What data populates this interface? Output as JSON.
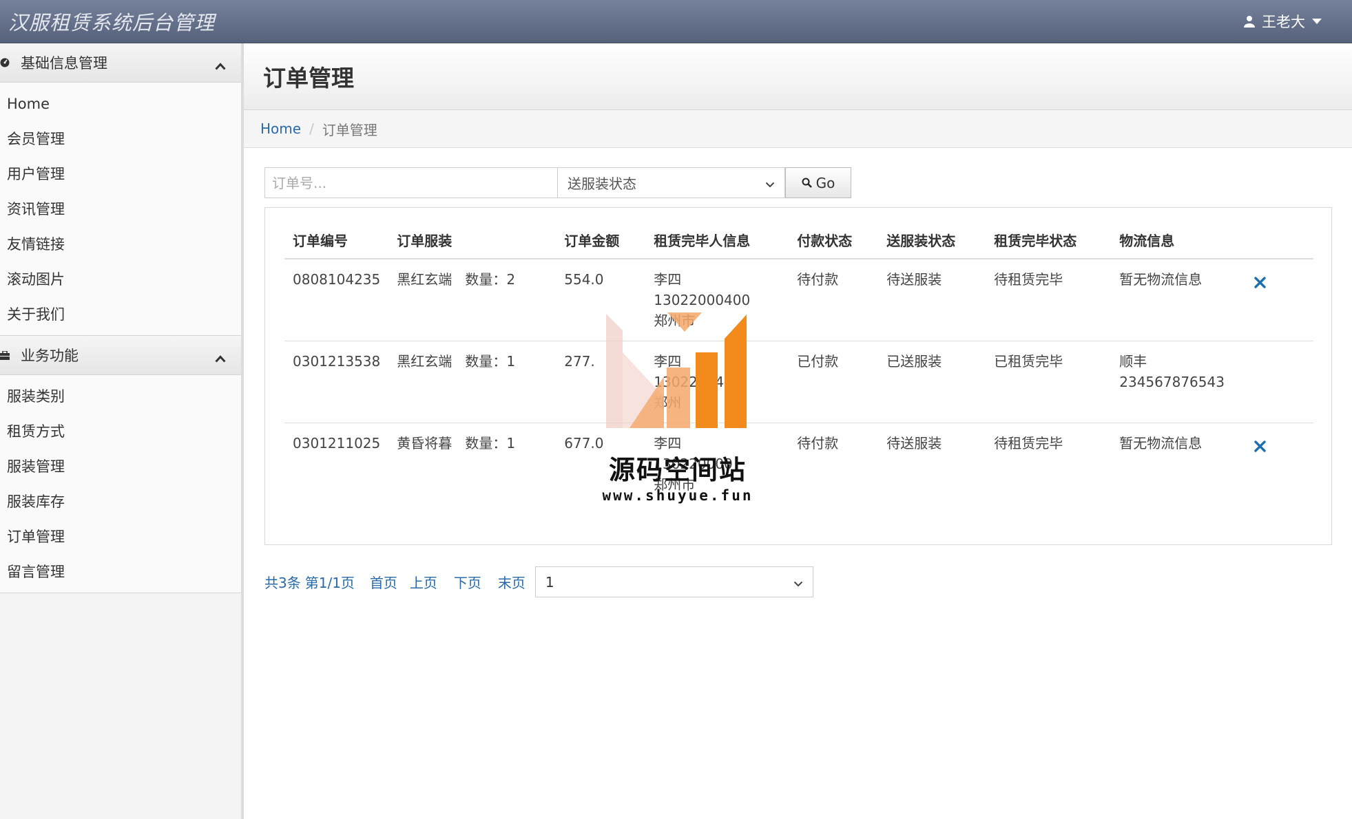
{
  "header": {
    "app_title": "汉服租赁系统后台管理",
    "user_name": "王老大"
  },
  "sidebar": {
    "groups": [
      {
        "title": "基础信息管理",
        "icon": "dashboard-icon",
        "items": [
          "Home",
          "会员管理",
          "用户管理",
          "资讯管理",
          "友情链接",
          "滚动图片",
          "关于我们"
        ]
      },
      {
        "title": "业务功能",
        "icon": "briefcase-icon",
        "items": [
          "服装类别",
          "租赁方式",
          "服装管理",
          "服装库存",
          "订单管理",
          "留言管理"
        ]
      }
    ]
  },
  "main": {
    "page_title": "订单管理",
    "breadcrumb": {
      "home": "Home",
      "separator": "/",
      "current": "订单管理"
    },
    "search": {
      "order_placeholder": "订单号...",
      "status_select_value": "送服装状态",
      "go_label": "Go"
    },
    "table": {
      "headers": [
        "订单编号",
        "订单服装",
        "订单金额",
        "租赁完毕人信息",
        "付款状态",
        "送服装状态",
        "租赁完毕状态",
        "物流信息"
      ],
      "rows": [
        {
          "order_no": "0808104235",
          "clothing": "黑红玄端",
          "qty_label": "数量：2",
          "amount": "554.0",
          "renter_name": "李四",
          "renter_phone": "13022000400",
          "renter_city": "郑州市",
          "pay_status": "待付款",
          "delivery_status": "待送服装",
          "rent_status": "待租赁完毕",
          "logistics_line1": "暂无物流信息",
          "logistics_line2": "",
          "deletable": true
        },
        {
          "order_no": "0301213538",
          "clothing": "黑红玄端",
          "qty_label": "数量：1",
          "amount": "277.",
          "renter_name": "李四",
          "renter_phone": "1302200400",
          "renter_city": "郑州",
          "pay_status": "已付款",
          "delivery_status": "已送服装",
          "rent_status": "已租赁完毕",
          "logistics_line1": "顺丰",
          "logistics_line2": "234567876543",
          "deletable": false
        },
        {
          "order_no": "0301211025",
          "clothing": "黄昏将暮",
          "qty_label": "数量：1",
          "amount": "677.0",
          "renter_name": "李四",
          "renter_phone": "130220000",
          "renter_city": "郑州市",
          "pay_status": "待付款",
          "delivery_status": "待送服装",
          "rent_status": "待租赁完毕",
          "logistics_line1": "暂无物流信息",
          "logistics_line2": "",
          "deletable": true
        }
      ]
    },
    "pagination": {
      "total": "共3条",
      "page_info": "第1/1页",
      "first": "首页",
      "prev": "上页",
      "next": "下页",
      "last": "末页",
      "page_select_value": "1"
    }
  },
  "watermark": {
    "title": "源码空间站",
    "url": "www.shuyue.fun"
  },
  "colors": {
    "topbar": "#5f6a84",
    "link": "#2a6aa8",
    "delete": "#1f6fae",
    "watermark_orange": "#f28a1c"
  }
}
